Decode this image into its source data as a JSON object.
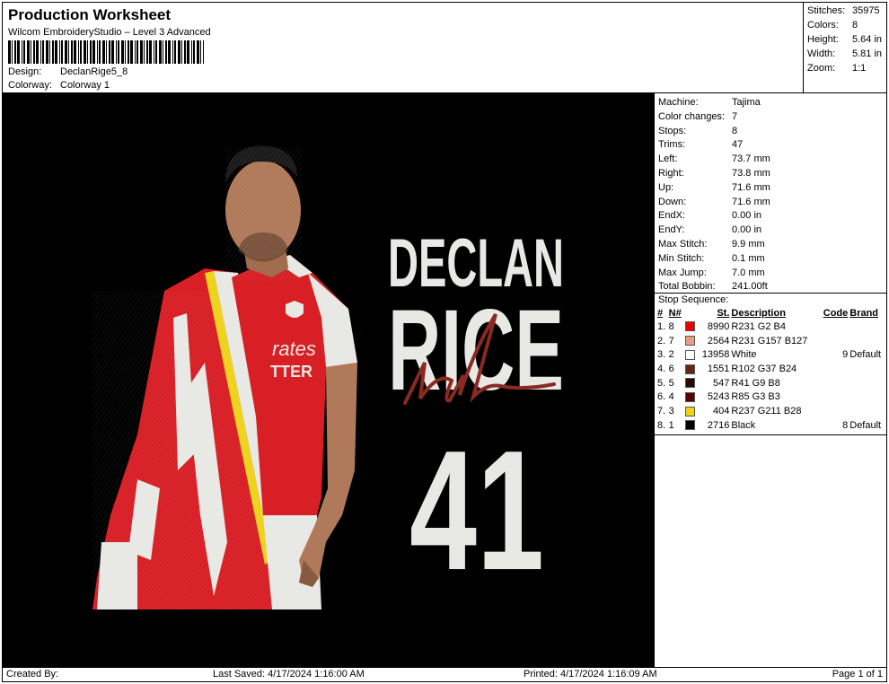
{
  "header": {
    "title": "Production Worksheet",
    "software": "Wilcom EmbroideryStudio – Level 3 Advanced",
    "design_label": "Design:",
    "design_value": "DeclanRige5_8",
    "colorway_label": "Colorway:",
    "colorway_value": "Colorway 1"
  },
  "stats": [
    {
      "label": "Stitches:",
      "value": "35975"
    },
    {
      "label": "Colors:",
      "value": "8"
    },
    {
      "label": "Height:",
      "value": "5.64 in"
    },
    {
      "label": "Width:",
      "value": "5.81 in"
    },
    {
      "label": "Zoom:",
      "value": "1:1"
    }
  ],
  "machine_info": [
    {
      "label": "Machine:",
      "value": "Tajima"
    },
    {
      "label": "Color changes:",
      "value": "7"
    },
    {
      "label": "Stops:",
      "value": "8"
    },
    {
      "label": "Trims:",
      "value": "47"
    },
    {
      "label": "Left:",
      "value": "73.7 mm"
    },
    {
      "label": "Right:",
      "value": "73.8 mm"
    },
    {
      "label": "Up:",
      "value": "71.6 mm"
    },
    {
      "label": "Down:",
      "value": "71.6 mm"
    },
    {
      "label": "EndX:",
      "value": "0.00 in"
    },
    {
      "label": "EndY:",
      "value": "0.00 in"
    },
    {
      "label": "Max Stitch:",
      "value": "9.9 mm"
    },
    {
      "label": "Min Stitch:",
      "value": "0.1 mm"
    },
    {
      "label": "Max Jump:",
      "value": "7.0 mm"
    },
    {
      "label": "Total Bobbin:",
      "value": "241.00ft"
    }
  ],
  "stop_sequence": {
    "title": "Stop Sequence:",
    "columns": {
      "hash": "#",
      "n": "N#",
      "st": "St.",
      "description": "Description",
      "code": "Code",
      "brand": "Brand"
    },
    "rows": [
      {
        "idx": "1.",
        "n": "8",
        "color": "#e70204",
        "st": "8990",
        "description": "R231 G2 B4",
        "code": "",
        "brand": ""
      },
      {
        "idx": "2.",
        "n": "7",
        "color": "#e79d7f",
        "st": "2564",
        "description": "R231 G157 B127",
        "code": "",
        "brand": ""
      },
      {
        "idx": "3.",
        "n": "2",
        "color": "#ffffff",
        "st": "13958",
        "description": "White",
        "code": "9",
        "brand": "Default"
      },
      {
        "idx": "4.",
        "n": "6",
        "color": "#662518",
        "st": "1551",
        "description": "R102 G37 B24",
        "code": "",
        "brand": ""
      },
      {
        "idx": "5.",
        "n": "5",
        "color": "#290908",
        "st": "547",
        "description": "R41 G9 B8",
        "code": "",
        "brand": ""
      },
      {
        "idx": "6.",
        "n": "4",
        "color": "#550303",
        "st": "5243",
        "description": "R85 G3 B3",
        "code": "",
        "brand": ""
      },
      {
        "idx": "7.",
        "n": "3",
        "color": "#edd31c",
        "st": "404",
        "description": "R237 G211 B28",
        "code": "",
        "brand": ""
      },
      {
        "idx": "8.",
        "n": "1",
        "color": "#000000",
        "st": "2716",
        "description": "Black",
        "code": "8",
        "brand": "Default"
      }
    ]
  },
  "design_art": {
    "name_line1": "DECLAN",
    "name_line2": "RICE",
    "number": "41",
    "sponsor_line1": "rates",
    "sponsor_line2": "TTER",
    "colors": {
      "red": "#d81f26",
      "white": "#e8e8e4",
      "skin": "#b07a5a",
      "yellow": "#edd31c",
      "signature": "#8a2a22"
    }
  },
  "footer": {
    "created_by": "Created By:",
    "last_saved": "Last Saved: 4/17/2024 1:16:00 AM",
    "printed": "Printed: 4/17/2024 1:16:09 AM",
    "page": "Page 1 of 1"
  }
}
